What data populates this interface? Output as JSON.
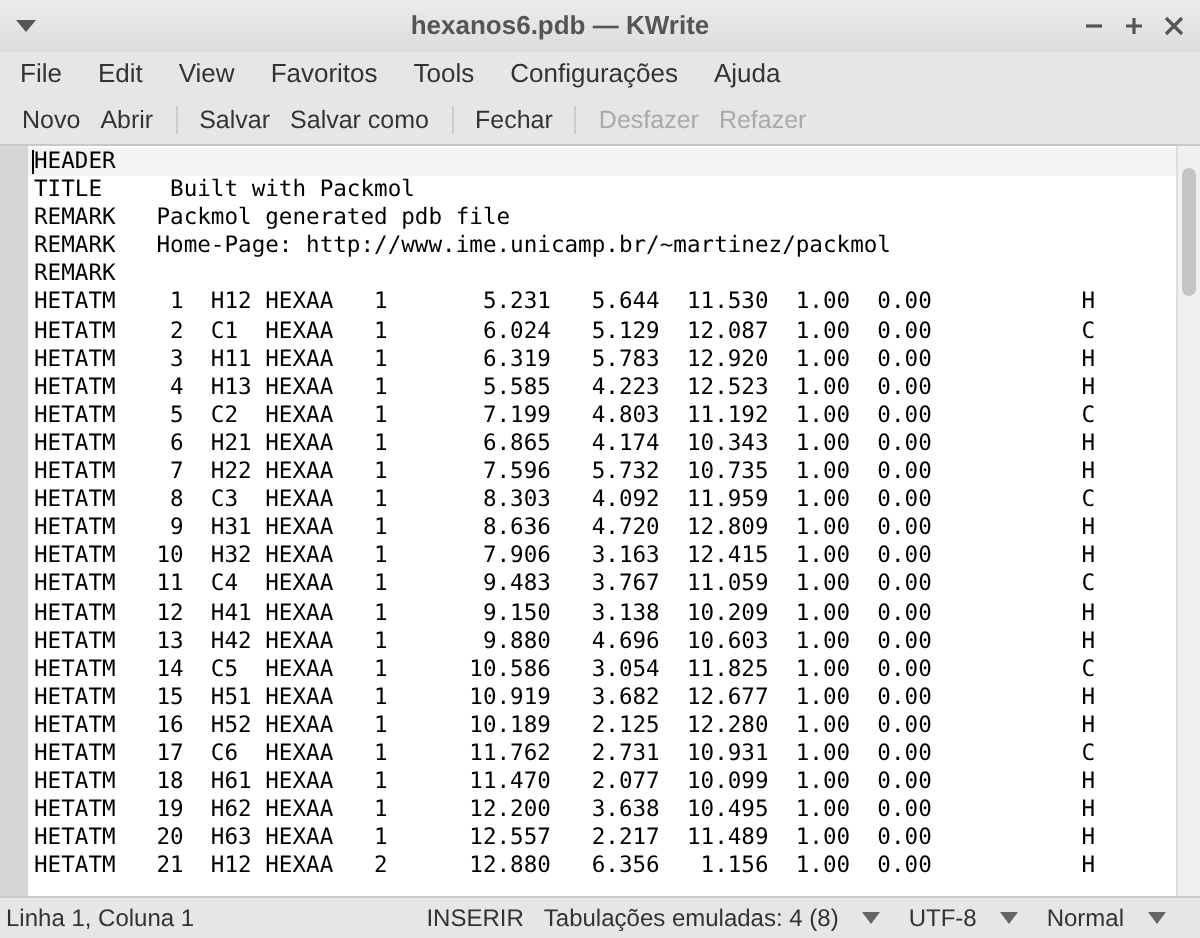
{
  "window": {
    "title": "hexanos6.pdb — KWrite"
  },
  "menu": [
    "File",
    "Edit",
    "View",
    "Favoritos",
    "Tools",
    "Configurações",
    "Ajuda"
  ],
  "toolbar": [
    {
      "label": "Novo",
      "disabled": false,
      "separator_after": false
    },
    {
      "label": "Abrir",
      "disabled": false,
      "separator_after": true
    },
    {
      "label": "Salvar",
      "disabled": false,
      "separator_after": false
    },
    {
      "label": "Salvar como",
      "disabled": false,
      "separator_after": true
    },
    {
      "label": "Fechar",
      "disabled": false,
      "separator_after": true
    },
    {
      "label": "Desfazer",
      "disabled": true,
      "separator_after": false
    },
    {
      "label": "Refazer",
      "disabled": true,
      "separator_after": false
    }
  ],
  "editor": {
    "lines": [
      {
        "text": "HEADER",
        "current": true
      },
      {
        "text": "TITLE     Built with Packmol",
        "current": false
      },
      {
        "text": "REMARK   Packmol generated pdb file",
        "current": false
      },
      {
        "text": "REMARK   Home-Page: http://www.ime.unicamp.br/~martinez/packmol",
        "current": false
      },
      {
        "text": "REMARK",
        "current": false
      },
      {
        "text": "HETATM    1  H12 HEXAA   1       5.231   5.644  11.530  1.00  0.00           H",
        "current": false
      },
      {
        "text": "HETATM    2  C1  HEXAA   1       6.024   5.129  12.087  1.00  0.00           C",
        "current": false
      },
      {
        "text": "HETATM    3  H11 HEXAA   1       6.319   5.783  12.920  1.00  0.00           H",
        "current": false
      },
      {
        "text": "HETATM    4  H13 HEXAA   1       5.585   4.223  12.523  1.00  0.00           H",
        "current": false
      },
      {
        "text": "HETATM    5  C2  HEXAA   1       7.199   4.803  11.192  1.00  0.00           C",
        "current": false
      },
      {
        "text": "HETATM    6  H21 HEXAA   1       6.865   4.174  10.343  1.00  0.00           H",
        "current": false
      },
      {
        "text": "HETATM    7  H22 HEXAA   1       7.596   5.732  10.735  1.00  0.00           H",
        "current": false
      },
      {
        "text": "HETATM    8  C3  HEXAA   1       8.303   4.092  11.959  1.00  0.00           C",
        "current": false
      },
      {
        "text": "HETATM    9  H31 HEXAA   1       8.636   4.720  12.809  1.00  0.00           H",
        "current": false
      },
      {
        "text": "HETATM   10  H32 HEXAA   1       7.906   3.163  12.415  1.00  0.00           H",
        "current": false
      },
      {
        "text": "HETATM   11  C4  HEXAA   1       9.483   3.767  11.059  1.00  0.00           C",
        "current": false
      },
      {
        "text": "HETATM   12  H41 HEXAA   1       9.150   3.138  10.209  1.00  0.00           H",
        "current": false
      },
      {
        "text": "HETATM   13  H42 HEXAA   1       9.880   4.696  10.603  1.00  0.00           H",
        "current": false
      },
      {
        "text": "HETATM   14  C5  HEXAA   1      10.586   3.054  11.825  1.00  0.00           C",
        "current": false
      },
      {
        "text": "HETATM   15  H51 HEXAA   1      10.919   3.682  12.677  1.00  0.00           H",
        "current": false
      },
      {
        "text": "HETATM   16  H52 HEXAA   1      10.189   2.125  12.280  1.00  0.00           H",
        "current": false
      },
      {
        "text": "HETATM   17  C6  HEXAA   1      11.762   2.731  10.931  1.00  0.00           C",
        "current": false
      },
      {
        "text": "HETATM   18  H61 HEXAA   1      11.470   2.077  10.099  1.00  0.00           H",
        "current": false
      },
      {
        "text": "HETATM   19  H62 HEXAA   1      12.200   3.638  10.495  1.00  0.00           H",
        "current": false
      },
      {
        "text": "HETATM   20  H63 HEXAA   1      12.557   2.217  11.489  1.00  0.00           H",
        "current": false
      },
      {
        "text": "HETATM   21  H12 HEXAA   2      12.880   6.356   1.156  1.00  0.00           H",
        "current": false
      }
    ]
  },
  "status_bar": {
    "position": "Linha 1, Coluna 1",
    "mode": "INSERIR",
    "dropdowns": [
      "Tabulações emuladas: 4 (8)",
      "UTF-8",
      "Normal"
    ]
  }
}
